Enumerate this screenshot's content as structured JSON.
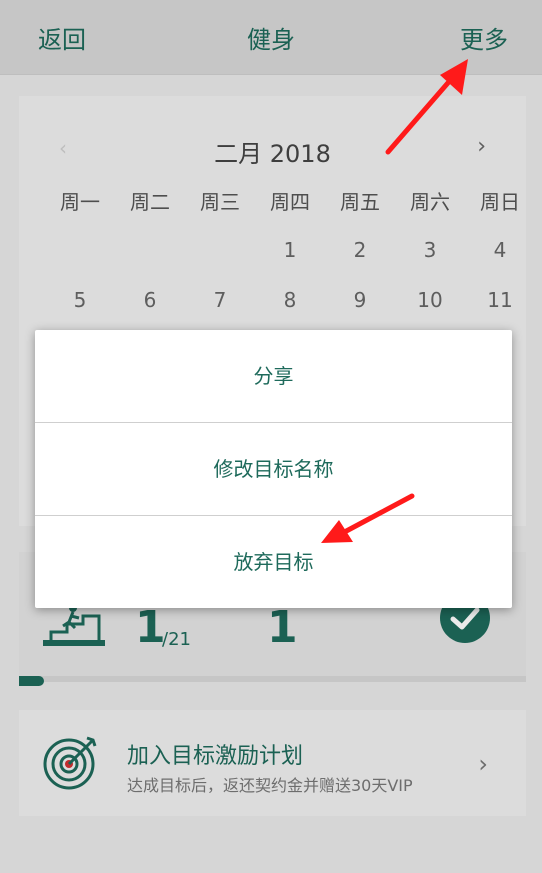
{
  "header": {
    "back_label": "返回",
    "title": "健身",
    "more_label": "更多"
  },
  "calendar": {
    "month_label": "二月 2018",
    "prev_symbol": "‹",
    "next_symbol": "›",
    "weekdays": [
      "周一",
      "周二",
      "周三",
      "周四",
      "周五",
      "周六",
      "周日"
    ],
    "rows": [
      [
        "",
        "",
        "",
        "1",
        "2",
        "3",
        "4"
      ],
      [
        "5",
        "6",
        "7",
        "8",
        "9",
        "10",
        "11"
      ]
    ]
  },
  "progress": {
    "completed_count": "1",
    "total_label": "/21",
    "streak_count": "1",
    "progress_fraction": 0.05
  },
  "plan": {
    "title": "加入目标激励计划",
    "subtitle": "达成目标后，返还契约金并赠送30天VIP",
    "chevron_symbol": "›"
  },
  "menu": {
    "items": [
      "分享",
      "修改目标名称",
      "放弃目标"
    ]
  },
  "colors": {
    "accent": "#1e6a5b",
    "annotation": "#ff1a1a"
  },
  "icons": [
    "stairs-icon",
    "check-circle-icon",
    "target-icon",
    "chevron-right-icon",
    "chevron-left-icon"
  ]
}
